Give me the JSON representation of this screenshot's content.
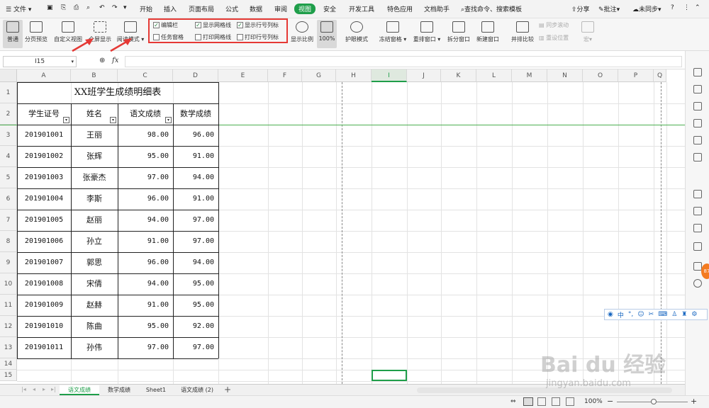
{
  "menu": {
    "file": "文件",
    "tabs": [
      "开始",
      "插入",
      "页面布局",
      "公式",
      "数据",
      "审阅",
      "视图",
      "安全",
      "开发工具",
      "特色应用",
      "文档助手"
    ],
    "active_tab": "视图",
    "search": "查找命令、搜索模板",
    "share": "分享",
    "comment": "批注",
    "sync": "未同步",
    "help": "?"
  },
  "ribbon": {
    "normal": "普通",
    "page_break": "分页预览",
    "custom_view": "自定义视图",
    "full_screen": "全屏显示",
    "reading_mode": "阅读模式",
    "show_checks": [
      {
        "label": "编辑栏",
        "checked": true
      },
      {
        "label": "显示网格线",
        "checked": true
      },
      {
        "label": "显示行号列标",
        "checked": true
      },
      {
        "label": "任务窗格",
        "checked": false
      },
      {
        "label": "打印网格线",
        "checked": false
      },
      {
        "label": "打印行号列标",
        "checked": false
      }
    ],
    "zoom_ratio": "显示比例",
    "zoom_100": "100%",
    "eye_mode": "护眼模式",
    "freeze": "冻结窗格",
    "rearrange": "重排窗口",
    "split": "拆分窗口",
    "new_window": "新建窗口",
    "side_by_side": "并排比较",
    "sync_scroll": "同步滚动",
    "reset_pos": "重设位置",
    "macro": "宏"
  },
  "formula_bar": {
    "name_box": "I15",
    "fx": "fx",
    "content": ""
  },
  "columns": [
    "A",
    "B",
    "C",
    "D",
    "E",
    "F",
    "G",
    "H",
    "I",
    "J",
    "K",
    "L",
    "M",
    "N",
    "O",
    "P",
    "Q"
  ],
  "active_column": "I",
  "rows": [
    "1",
    "2",
    "3",
    "4",
    "5",
    "6",
    "7",
    "8",
    "9",
    "10",
    "11",
    "12",
    "13",
    "14",
    "15"
  ],
  "table": {
    "title": "XX班学生成绩明细表",
    "headers": [
      "学生证号",
      "姓名",
      "语文成绩",
      "数学成绩"
    ],
    "data": [
      [
        "201901001",
        "王丽",
        "98.00",
        "96.00"
      ],
      [
        "201901002",
        "张辉",
        "95.00",
        "91.00"
      ],
      [
        "201901003",
        "张豪杰",
        "97.00",
        "94.00"
      ],
      [
        "201901004",
        "李斯",
        "96.00",
        "91.00"
      ],
      [
        "201901005",
        "赵丽",
        "94.00",
        "97.00"
      ],
      [
        "201901006",
        "孙立",
        "91.00",
        "97.00"
      ],
      [
        "201901007",
        "郭思",
        "96.00",
        "94.00"
      ],
      [
        "201901008",
        "宋倩",
        "94.00",
        "95.00"
      ],
      [
        "201901009",
        "赵赫",
        "91.00",
        "95.00"
      ],
      [
        "201901010",
        "陈曲",
        "95.00",
        "92.00"
      ],
      [
        "201901011",
        "孙伟",
        "97.00",
        "97.00"
      ]
    ]
  },
  "sheet_tabs": [
    "语文成绩",
    "数学成绩",
    "Sheet1",
    "语文成绩 (2)"
  ],
  "active_sheet": "语文成绩",
  "status": {
    "zoom": "100%"
  },
  "ime_toolbar": {
    "lang": "中"
  },
  "badge": "87",
  "watermark": {
    "brand": "Bai du 经验",
    "url": "jingyan.baidu.com"
  },
  "colors": {
    "accent": "#1f9e4a",
    "highlight_box": "#e53935",
    "arrow": "#e53935"
  }
}
